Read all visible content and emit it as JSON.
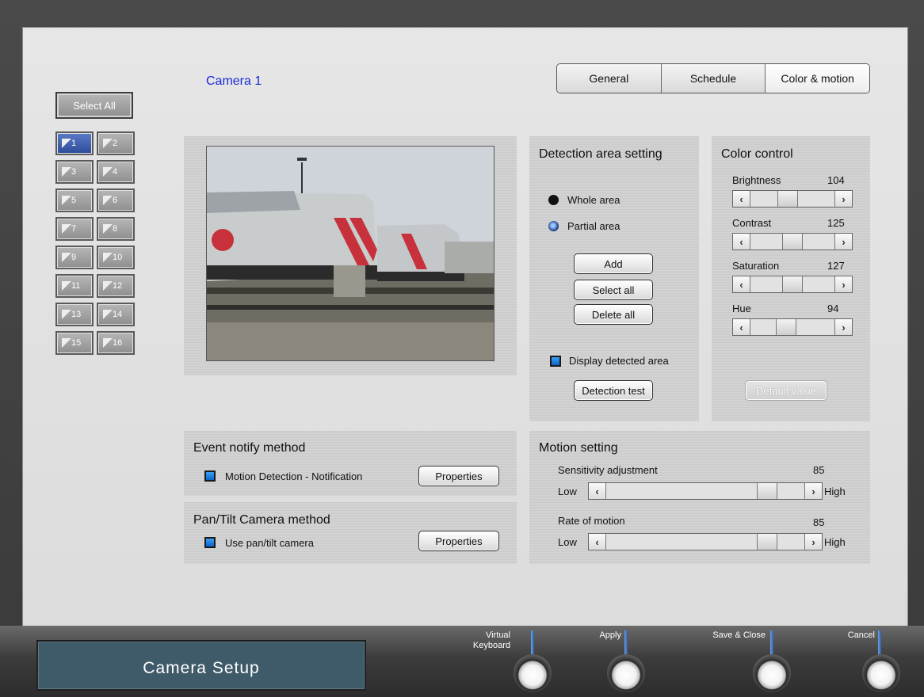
{
  "camera_title": "Camera 1",
  "tabs": [
    {
      "label": "General",
      "active": false
    },
    {
      "label": "Schedule",
      "active": false
    },
    {
      "label": "Color & motion",
      "active": true
    }
  ],
  "select_all_label": "Select All",
  "camera_buttons": [
    "1",
    "2",
    "3",
    "4",
    "5",
    "6",
    "7",
    "8",
    "9",
    "10",
    "11",
    "12",
    "13",
    "14",
    "15",
    "16"
  ],
  "active_camera": "1",
  "detection": {
    "title": "Detection area setting",
    "whole_area": "Whole area",
    "partial_area": "Partial area",
    "selected_area": "Partial area",
    "add": "Add",
    "select_all": "Select all",
    "delete_all": "Delete all",
    "display_detected_area": "Display detected area",
    "display_detected_area_checked": true,
    "detection_test": "Detection test"
  },
  "color_control": {
    "title": "Color control",
    "brightness": {
      "label": "Brightness",
      "value": "104"
    },
    "contrast": {
      "label": "Contrast",
      "value": "125"
    },
    "saturation": {
      "label": "Saturation",
      "value": "127"
    },
    "hue": {
      "label": "Hue",
      "value": "94"
    },
    "default_value": "Default value"
  },
  "event_notify": {
    "title": "Event notify method",
    "option": "Motion Detection - Notification",
    "checked": true,
    "properties": "Properties"
  },
  "pan_tilt": {
    "title": "Pan/Tilt Camera method",
    "option": "Use pan/tilt camera",
    "checked": true,
    "properties": "Properties"
  },
  "motion": {
    "title": "Motion setting",
    "sensitivity": {
      "label": "Sensitivity adjustment",
      "value": "85"
    },
    "rate": {
      "label": "Rate of motion",
      "value": "85"
    },
    "low": "Low",
    "high": "High"
  },
  "footer": {
    "title": "Camera Setup",
    "virtual_keyboard": "Virtual Keyboard",
    "apply": "Apply",
    "save_close": "Save & Close",
    "cancel": "Cancel"
  }
}
